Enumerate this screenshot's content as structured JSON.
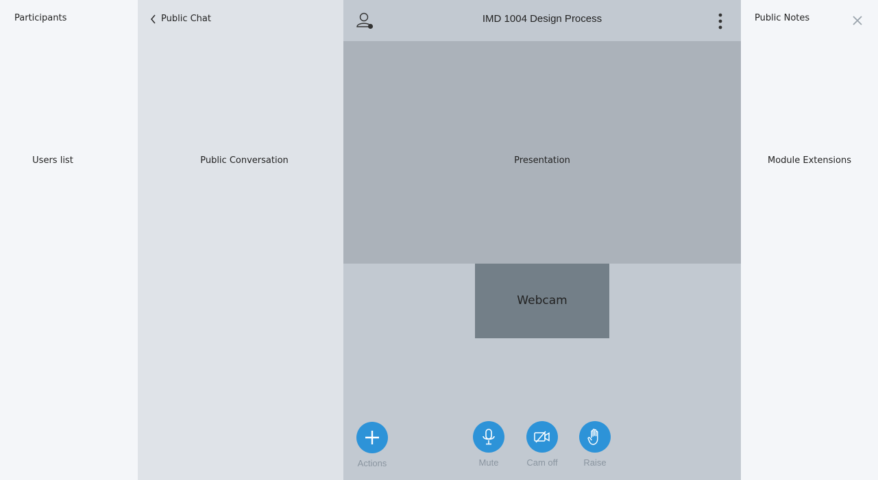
{
  "participants": {
    "title": "Participants",
    "placeholder": "Users list"
  },
  "chat": {
    "title": "Public Chat",
    "placeholder": "Public Conversation"
  },
  "header": {
    "title": "IMD 1004 Design Process",
    "user_icon": "user-status-icon",
    "more_icon": "more-vertical-icon"
  },
  "presentation": {
    "label": "Presentation"
  },
  "webcam": {
    "label": "Webcam"
  },
  "controls": {
    "actions": "Actions",
    "mute": "Mute",
    "cam_off": "Cam off",
    "raise": "Raise"
  },
  "notes": {
    "title": "Public Notes",
    "placeholder": "Module Extensions",
    "close_icon": "close-icon"
  },
  "colors": {
    "accent": "#2d93d8",
    "sidebar_bg": "#f4f6f9",
    "chat_bg": "#dfe3e8",
    "main_bg": "#c2c9d1",
    "presentation_bg": "#abb2ba",
    "webcam_bg": "#737f88"
  }
}
